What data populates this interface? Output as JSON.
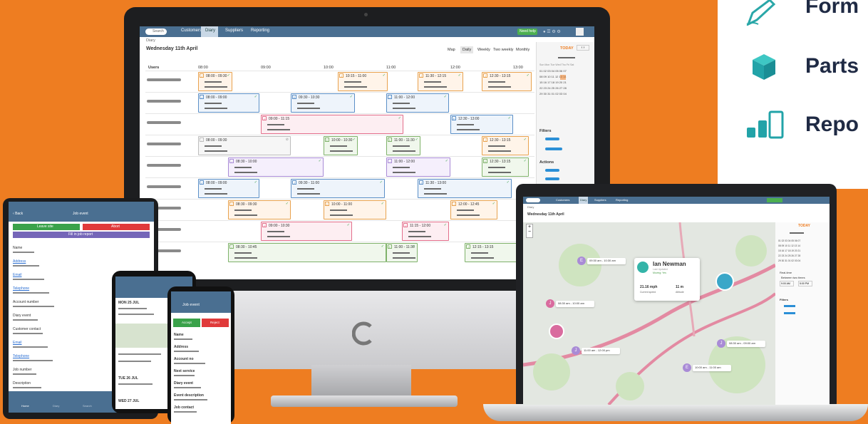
{
  "features": [
    "Form",
    "Parts",
    "Repo"
  ],
  "diary": {
    "nav": {
      "search": "Search",
      "items": [
        "Customers",
        "Diary",
        "Suppliers",
        "Reporting"
      ],
      "help": "Need help"
    },
    "breadcrumb": "Diary",
    "date_title": "Wednesday 11th April",
    "view_tabs": [
      "Map",
      "Daily",
      "Weekly",
      "Two weekly",
      "Monthly"
    ],
    "today": "TODAY",
    "users_label": "Users",
    "times": [
      "08:00",
      "09:00",
      "10:00",
      "11:00",
      "12:00",
      "13:00"
    ],
    "filters": "Filters",
    "actions": "Actions",
    "cal_days": "Sun Mon Tue Wed Thu Fri Sat",
    "cal_rows": [
      "01 02 03 04 05 06 07",
      "08 09 10 11 12 13 14",
      "15 16 17 18 19 20 21",
      "22 23 24 25 26 27 28",
      "29 30 31 01 02 03 04"
    ],
    "blocks": [
      {
        "label": "08:00 - 09:30",
        "tag": "J",
        "color": "#e8a24e"
      },
      {
        "label": "10:15 - 11:00",
        "tag": "J",
        "color": "#e8a24e"
      },
      {
        "label": "11:30 - 12:15",
        "tag": "J",
        "color": "#e8a24e"
      },
      {
        "label": "12:30 - 13:15",
        "tag": "J",
        "color": "#e8a24e"
      },
      {
        "label": "08:00 - 09:00",
        "tag": "J",
        "color": "#5b8fc7"
      },
      {
        "label": "09:30 - 10:30",
        "tag": "E",
        "color": "#5b8fc7"
      },
      {
        "label": "11:00 - 12:00",
        "tag": "J",
        "color": "#5b8fc7"
      },
      {
        "label": "09:00 - 11:15",
        "tag": "J",
        "color": "#e36f8b"
      },
      {
        "label": "12:30 - 13:00",
        "tag": "E",
        "color": "#5b8fc7"
      },
      {
        "label": "08:00 - 09:30",
        "tag": "J",
        "color": "#bdbdbd"
      },
      {
        "label": "10:00 - 10:30",
        "tag": "E",
        "color": "#7fb26a"
      },
      {
        "label": "11:00 - 11:30",
        "tag": "E",
        "color": "#7fb26a"
      },
      {
        "label": "12:30 - 13:15",
        "tag": "J",
        "color": "#e8a24e"
      },
      {
        "label": "08:30 - 10:00",
        "tag": "J",
        "color": "#a98bd6"
      },
      {
        "label": "11:00 - 12:00",
        "tag": "J",
        "color": "#a98bd6"
      },
      {
        "label": "12:30 - 13:15",
        "tag": "E",
        "color": "#7fb26a"
      },
      {
        "label": "08:00 - 09:00",
        "tag": "J",
        "color": "#5b8fc7"
      },
      {
        "label": "09:30 - 11:00",
        "tag": "J",
        "color": "#5b8fc7"
      },
      {
        "label": "11:30 - 13:00",
        "tag": "J",
        "color": "#5b8fc7"
      },
      {
        "label": "08:30 - 09:30",
        "tag": "J",
        "color": "#e8a24e"
      },
      {
        "label": "10:00 - 11:00",
        "tag": "E",
        "color": "#e8a24e"
      },
      {
        "label": "12:00 - 12:45",
        "tag": "J",
        "color": "#e8a24e"
      },
      {
        "label": "09:00 - 10:30",
        "tag": "J",
        "color": "#e36f8b"
      },
      {
        "label": "11:15 - 12:00",
        "tag": "J",
        "color": "#e36f8b"
      },
      {
        "label": "08:30 - 10:45",
        "tag": "J",
        "color": "#7fb26a"
      },
      {
        "label": "11:00 - 11:30",
        "tag": "E",
        "color": "#7fb26a"
      },
      {
        "label": "12:15 - 13:15",
        "tag": "J",
        "color": "#7fb26a"
      }
    ]
  },
  "laptop": {
    "date_title": "Wednesday 11th April",
    "person": "Ian Newman",
    "status": "Moving: Yes",
    "last_updated": "Last Updated",
    "speed": "21.16 mph",
    "speed_label": "Current speed",
    "altitude": "11 m",
    "altitude_label": "Altitude",
    "pins": [
      "09:30 am - 10:30 am",
      "08:30 am - 10:00 am",
      "11:00 am - 12:00 pm",
      "08:30 am - 09:00 am",
      "10:00 am - 11:00 am"
    ],
    "realtime": "Real-time",
    "between": "Between two times",
    "time_from": "9:00 AM",
    "time_to": "5:00 PM",
    "filters": "Filters"
  },
  "tablet": {
    "back": "Back",
    "title": "Job event",
    "leave": "Leave site",
    "abort": "Abort",
    "fill": "Fill in job report",
    "fields": [
      "Name",
      "Address",
      "Email",
      "Telephone",
      "Account number",
      "Diary event",
      "Customer contact",
      "Email",
      "Telephone",
      "Job number",
      "Description"
    ],
    "tabs": [
      "Home",
      "Diary",
      "Search",
      "More"
    ]
  },
  "phone1": {
    "date": "MON 25 JUL",
    "date2": "TUE 26 JUL",
    "date3": "WED 27 JUL"
  },
  "phone2": {
    "title": "Job event",
    "accept": "Accept",
    "reject": "Reject",
    "fields": [
      "Name",
      "Address",
      "Account no",
      "Next service",
      "Diary event",
      "Event description",
      "Job contact"
    ]
  }
}
